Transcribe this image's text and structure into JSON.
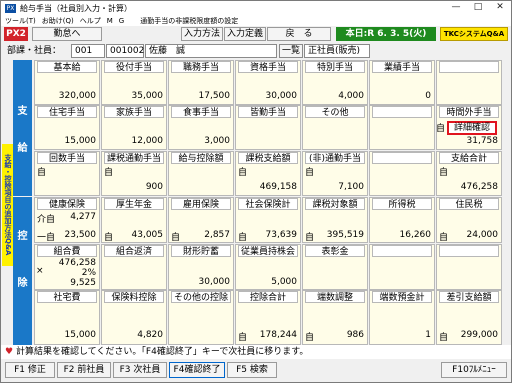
{
  "window": {
    "title": "給与手当（社員別入力・計算）",
    "icon_text": "PX",
    "minimize": "—",
    "maximize": "□",
    "close": "✕"
  },
  "menu": {
    "tool": "ツール(T)",
    "omakase": "お助け(Q)",
    "help": "ヘルプ",
    "icon": "M",
    "path": "通勤手当の非課税限度額の設定",
    "path_icon": "G"
  },
  "toolbar": {
    "px2": "PX2",
    "kintai": "勤怠へ",
    "input_method": "入力方法",
    "input_def": "入力定義",
    "back": "戻　る",
    "date": "本日:R 6. 3. 5(火)",
    "tkc": "TKCシステムQ&A"
  },
  "employee": {
    "bukasha_label": "部課・社員：",
    "bu": "001",
    "code": "001002",
    "name": "佐藤　誠",
    "ichiran": "一覧",
    "type": "正社員(販売)"
  },
  "side": {
    "shi": "支",
    "kyu": "給",
    "kou": "控",
    "jo": "除",
    "yellow": "支給・控除項目の追加方法Q&A"
  },
  "shikyu": {
    "r1_headers": [
      "基本給",
      "役付手当",
      "職務手当",
      "資格手当",
      "特別手当",
      "業績手当",
      ""
    ],
    "r1_values": [
      "320,000",
      "35,000",
      "17,500",
      "30,000",
      "4,000",
      "0",
      ""
    ],
    "r2_headers": [
      "住宅手当",
      "家族手当",
      "食事手当",
      "皆勤手当",
      "その他",
      "",
      "時間外手当"
    ],
    "r2_values": [
      "15,000",
      "12,000",
      "3,000",
      "",
      "",
      "",
      "31,758"
    ],
    "r2_ji": "自",
    "detail": "詳細確認",
    "r3_headers": [
      "回数手当",
      "課税通勤手当",
      "給与控除額",
      "課税支給額",
      "(非)通勤手当",
      "",
      "支給合計"
    ],
    "r3_values": [
      "",
      "900",
      "",
      "469,158",
      "7,100",
      "",
      "476,258"
    ],
    "r3_ji": [
      "自",
      "自",
      "",
      "自",
      "自",
      "",
      "自"
    ]
  },
  "kojo": {
    "r1_headers": [
      "健康保険",
      "厚生年金",
      "雇用保険",
      "社会保険計",
      "課税対象額",
      "所得税",
      "住民税"
    ],
    "r1_top": [
      "介自",
      "",
      "",
      "",
      "",
      "",
      ""
    ],
    "r1_top_val": "4,277",
    "r1_bottom_prefix": [
      "一自",
      "自",
      "自",
      "自",
      "自",
      "",
      "自"
    ],
    "r1_values": [
      "23,500",
      "43,005",
      "2,857",
      "73,639",
      "395,519",
      "16,260",
      "24,000"
    ],
    "r2_headers": [
      "組合費",
      "組合返済",
      "財形貯蓄",
      "従業員持株会",
      "表彰金",
      "",
      ""
    ],
    "r2_x": "×",
    "r2_lines": [
      "476,258",
      "2%",
      "9,525"
    ],
    "r2_values": [
      "",
      "",
      "30,000",
      "5,000",
      "",
      "",
      ""
    ],
    "r3_headers": [
      "社宅費",
      "保険料控除",
      "その他の控除",
      "控除合計",
      "端数調整",
      "端数預金計",
      "差引支給額"
    ],
    "r3_values": [
      "15,000",
      "4,820",
      "",
      "178,244",
      "986",
      "1",
      "299,000"
    ],
    "r3_ji": [
      "",
      "",
      "",
      "自",
      "自",
      "",
      "自"
    ]
  },
  "status": {
    "heart": "♥",
    "text": "計算結果を確認してください。「F4確認終了」キーで次社員に移ります。"
  },
  "fkeys": [
    "F1 修正",
    "F2 前社員",
    "F3 次社員",
    "F4確認終了",
    "F5 検索",
    "F10ﾌﾙﾒﾆｭｰ"
  ]
}
